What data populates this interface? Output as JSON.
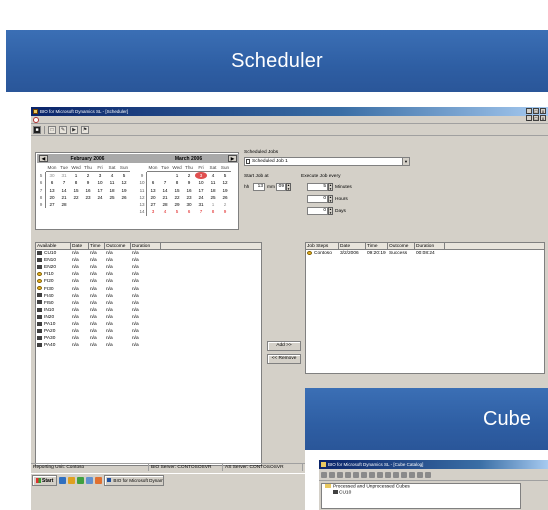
{
  "slide": {
    "title": "Scheduler",
    "second_title": "Cube"
  },
  "window": {
    "title": "BIO for Microsoft Dynamics SL - [Scheduler]",
    "controls": [
      "_",
      "&#x25A1;",
      "x"
    ]
  },
  "calendar_left": {
    "month": "February 2006",
    "days_of_week": [
      "Mon",
      "Tue",
      "Wed",
      "Thu",
      "Fri",
      "Sat",
      "Sun"
    ],
    "weeks": [
      {
        "wk": "5",
        "days": [
          "30",
          "31",
          "1",
          "2",
          "3",
          "4",
          "5"
        ]
      },
      {
        "wk": "6",
        "days": [
          "6",
          "7",
          "8",
          "9",
          "10",
          "11",
          "12"
        ]
      },
      {
        "wk": "7",
        "days": [
          "13",
          "14",
          "15",
          "16",
          "17",
          "18",
          "19"
        ]
      },
      {
        "wk": "8",
        "days": [
          "20",
          "21",
          "22",
          "23",
          "24",
          "25",
          "26"
        ]
      },
      {
        "wk": "9",
        "days": [
          "27",
          "28",
          "",
          "",
          "",
          "",
          ""
        ]
      }
    ]
  },
  "calendar_right": {
    "month": "March 2006",
    "days_of_week": [
      "Mon",
      "Tue",
      "Wed",
      "Thu",
      "Fri",
      "Sat",
      "Sun"
    ],
    "weeks": [
      {
        "wk": "9",
        "days": [
          "",
          "",
          "1",
          "2",
          "3",
          "4",
          "5"
        ]
      },
      {
        "wk": "10",
        "days": [
          "6",
          "7",
          "8",
          "9",
          "10",
          "11",
          "12"
        ]
      },
      {
        "wk": "11",
        "days": [
          "13",
          "14",
          "15",
          "16",
          "17",
          "18",
          "19"
        ]
      },
      {
        "wk": "12",
        "days": [
          "20",
          "21",
          "22",
          "23",
          "24",
          "25",
          "26"
        ]
      },
      {
        "wk": "13",
        "days": [
          "27",
          "28",
          "29",
          "30",
          "31",
          "1",
          "2"
        ]
      },
      {
        "wk": "14",
        "days": [
          "3",
          "4",
          "5",
          "6",
          "7",
          "8",
          "9"
        ]
      }
    ],
    "today": "3"
  },
  "schedule": {
    "jobs_label": "Scheduled Jobs",
    "selected_job": "Scheduled Job 1",
    "start_label": "Start Job at",
    "hh_label": "hh",
    "hh_value": "13",
    "mm_label": "mm",
    "mm_value": "09",
    "execute_label": "Execute Job every",
    "minutes_value": "5",
    "minutes_label": "Minutes",
    "hours_value": "0",
    "hours_label": "Hours",
    "days_value": "0",
    "days_label": "Days"
  },
  "available": {
    "headers": [
      "Available",
      "Date",
      "Time",
      "Outcome",
      "Duration"
    ],
    "rows": [
      {
        "name": "CU10",
        "icon": "cube-icon",
        "date": "n/a",
        "time": "n/a",
        "outcome": "n/a",
        "duration": "n/a"
      },
      {
        "name": "EN10",
        "icon": "cube-icon",
        "date": "n/a",
        "time": "n/a",
        "outcome": "n/a",
        "duration": "n/a"
      },
      {
        "name": "EN20",
        "icon": "cube-icon",
        "date": "n/a",
        "time": "n/a",
        "outcome": "n/a",
        "duration": "n/a"
      },
      {
        "name": "FI10",
        "icon": "warning-icon",
        "date": "n/a",
        "time": "n/a",
        "outcome": "n/a",
        "duration": "n/a"
      },
      {
        "name": "FI20",
        "icon": "warning-icon",
        "date": "n/a",
        "time": "n/a",
        "outcome": "n/a",
        "duration": "n/a"
      },
      {
        "name": "FI30",
        "icon": "warning-icon",
        "date": "n/a",
        "time": "n/a",
        "outcome": "n/a",
        "duration": "n/a"
      },
      {
        "name": "FI40",
        "icon": "cube-icon",
        "date": "n/a",
        "time": "n/a",
        "outcome": "n/a",
        "duration": "n/a"
      },
      {
        "name": "FI50",
        "icon": "cube-icon",
        "date": "n/a",
        "time": "n/a",
        "outcome": "n/a",
        "duration": "n/a"
      },
      {
        "name": "IN10",
        "icon": "cube-icon",
        "date": "n/a",
        "time": "n/a",
        "outcome": "n/a",
        "duration": "n/a"
      },
      {
        "name": "IN20",
        "icon": "cube-icon",
        "date": "n/a",
        "time": "n/a",
        "outcome": "n/a",
        "duration": "n/a"
      },
      {
        "name": "PA10",
        "icon": "cube-icon",
        "date": "n/a",
        "time": "n/a",
        "outcome": "n/a",
        "duration": "n/a"
      },
      {
        "name": "PA20",
        "icon": "cube-icon",
        "date": "n/a",
        "time": "n/a",
        "outcome": "n/a",
        "duration": "n/a"
      },
      {
        "name": "PA30",
        "icon": "cube-icon",
        "date": "n/a",
        "time": "n/a",
        "outcome": "n/a",
        "duration": "n/a"
      },
      {
        "name": "PA40",
        "icon": "cube-icon",
        "date": "n/a",
        "time": "n/a",
        "outcome": "n/a",
        "duration": "n/a"
      }
    ]
  },
  "buttons": {
    "add": "Add >>",
    "remove": "<< Remove"
  },
  "job_steps": {
    "headers": [
      "Job Steps",
      "Date",
      "Time",
      "Outcome",
      "Duration"
    ],
    "rows": [
      {
        "name": "Contoso",
        "date": "3/2/2006",
        "time": "09:20:19",
        "outcome": "Success",
        "duration": "00:08:24"
      }
    ]
  },
  "status": {
    "unit": "Reporting Unit: Contoso",
    "bio_server": "BIO Server: CONTOSOSVR",
    "as_server": "AS Server: CONTOSOSVR"
  },
  "taskbar": {
    "start": "Start",
    "task": "BIO for Microsoft Dynami..."
  },
  "cube_window": {
    "title": "BIO for Microsoft Dynamics SL - [Cube Catalog]",
    "tree_root": "Processed and Unprocessed Cubes",
    "tree_item": "CU10"
  }
}
